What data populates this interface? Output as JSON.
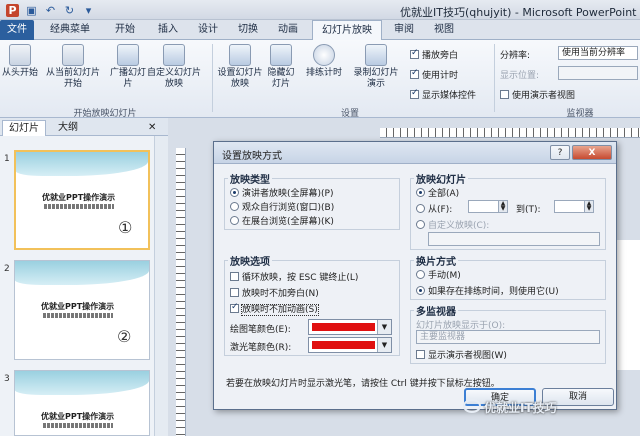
{
  "window": {
    "title": "优就业IT技巧(qhujyit) - Microsoft PowerPoint"
  },
  "ribbon_tabs": [
    "文件",
    "经典菜单",
    "开始",
    "插入",
    "设计",
    "切换",
    "动画",
    "幻灯片放映",
    "审阅",
    "视图"
  ],
  "ribbon": {
    "buttons": {
      "from_start": "从头开始",
      "from_current": "从当前幻灯片开始",
      "broadcast": "广播幻灯片",
      "custom_show": "自定义幻灯片放映",
      "setup_show": "设置幻灯片放映",
      "hide_slide": "隐藏幻灯片",
      "rehearse": "排练计时",
      "record": "录制幻灯片演示"
    },
    "checks": {
      "narration": "播放旁白",
      "timings": "使用计时",
      "media_controls": "显示媒体控件"
    },
    "monitors": {
      "resolution_label": "分辨率:",
      "resolution_value": "使用当前分辨率",
      "show_on_label": "显示位置:",
      "presenter_view": "使用演示者视图"
    },
    "group_labels": {
      "start": "开始放映幻灯片",
      "setup": "设置",
      "monitors": "监视器"
    }
  },
  "panel": {
    "tabs": [
      "幻灯片",
      "大纲"
    ],
    "slides": [
      {
        "num": "1",
        "title": "优就业PPT操作演示",
        "mark": "①"
      },
      {
        "num": "2",
        "title": "优就业PPT操作演示",
        "mark": "②"
      },
      {
        "num": "3",
        "title": "优就业PPT操作演示",
        "mark": ""
      }
    ]
  },
  "dialog": {
    "title": "设置放映方式",
    "help": "?",
    "close": "X",
    "show_type": {
      "header": "放映类型",
      "options": [
        "演讲者放映(全屏幕)(P)",
        "观众自行浏览(窗口)(B)",
        "在展台浏览(全屏幕)(K)"
      ]
    },
    "show_slides": {
      "header": "放映幻灯片",
      "all": "全部(A)",
      "from": "从(F):",
      "to": "到(T):",
      "custom": "自定义放映(C):"
    },
    "show_options": {
      "header": "放映选项",
      "loop": "循环放映，按 ESC 键终止(L)",
      "no_narration": "放映时不加旁白(N)",
      "no_animation": "放映时不加动画(S)",
      "pen_color": "绘图笔颜色(E):",
      "laser_color": "激光笔颜色(R):"
    },
    "advance": {
      "header": "换片方式",
      "manual": "手动(M)",
      "timings": "如果存在排练时间，则使用它(U)"
    },
    "monitors": {
      "header": "多监视器",
      "show_on": "幻灯片放映显示于(O):",
      "primary": "主要监视器",
      "presenter_view": "显示演示者视图(W)"
    },
    "hint": "若要在放映幻灯片时显示激光笔，请按住 Ctrl 键并按下鼠标左按钮。",
    "ok": "确定",
    "cancel": "取消",
    "colors": {
      "pen": "#e01010",
      "laser": "#e01010"
    }
  },
  "watermark": "优就业IT技巧"
}
